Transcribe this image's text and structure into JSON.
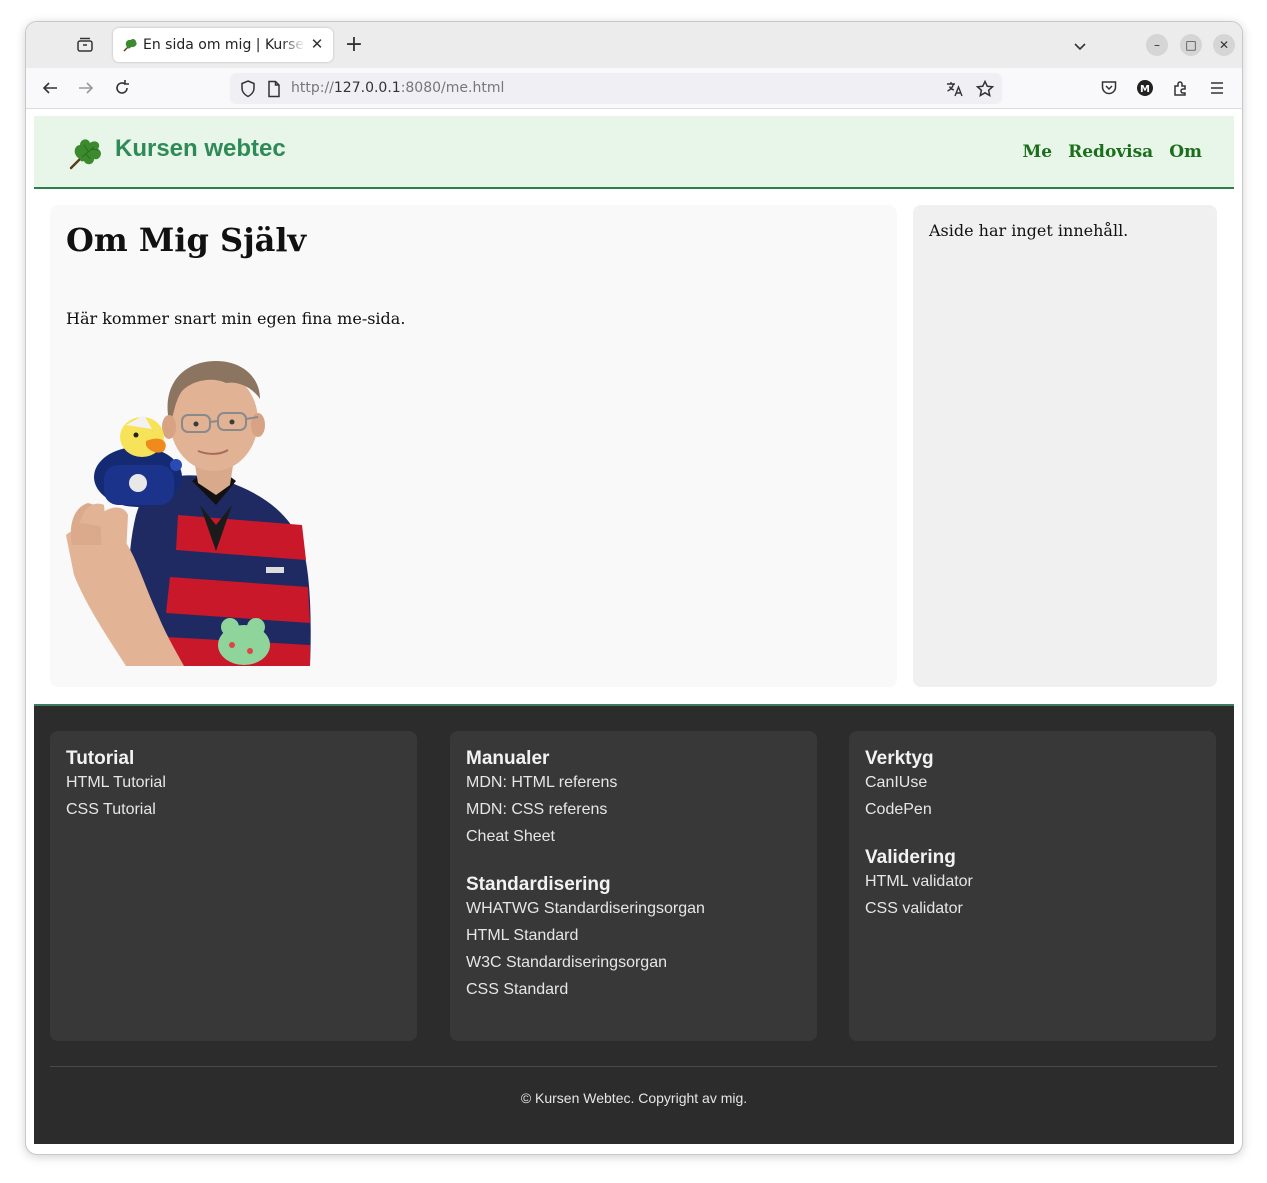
{
  "browser": {
    "tab_title": "En sida om mig | Kursen webtec",
    "url_prefix": "http://",
    "url_host": "127.0.0.1",
    "url_rest": ":8080/me.html"
  },
  "header": {
    "site_title": "Kursen webtec",
    "nav": [
      "Me",
      "Redovisa",
      "Om"
    ]
  },
  "main": {
    "heading": "Om Mig Själv",
    "intro": "Här kommer snart min egen fina me-sida."
  },
  "aside": {
    "text": "Aside har inget innehåll."
  },
  "footer": {
    "columns": [
      {
        "sections": [
          {
            "title": "Tutorial",
            "links": [
              "HTML Tutorial",
              "CSS Tutorial"
            ]
          }
        ]
      },
      {
        "sections": [
          {
            "title": "Manualer",
            "links": [
              "MDN: HTML referens",
              "MDN: CSS referens",
              "Cheat Sheet"
            ]
          },
          {
            "title": "Standardisering",
            "links": [
              "WHATWG Standardiseringsorgan",
              "HTML Standard",
              "W3C Standardiseringsorgan",
              "CSS Standard"
            ]
          }
        ]
      },
      {
        "sections": [
          {
            "title": "Verktyg",
            "links": [
              "CanIUse",
              "CodePen"
            ]
          },
          {
            "title": "Validering",
            "links": [
              "HTML validator",
              "CSS validator"
            ]
          }
        ]
      }
    ],
    "copyright": "© Kursen Webtec. Copyright av mig."
  }
}
